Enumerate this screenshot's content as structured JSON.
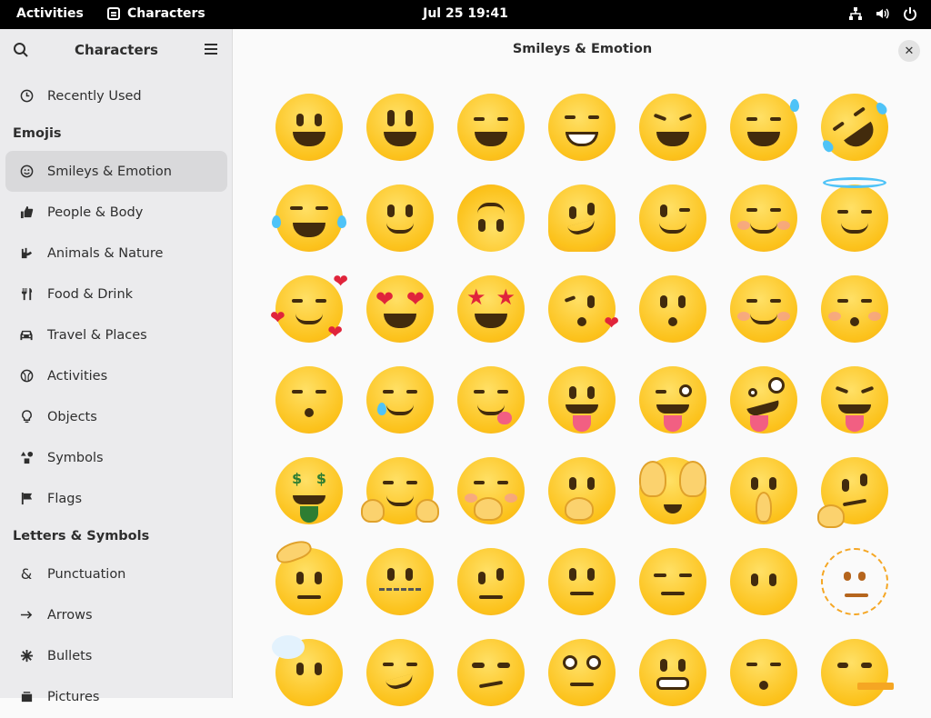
{
  "topbar": {
    "activities": "Activities",
    "app_name": "Characters",
    "clock": "Jul 25  19:41",
    "tray_icons": [
      "network-icon",
      "volume-icon",
      "power-icon"
    ]
  },
  "sidebar": {
    "title": "Characters",
    "items_top": [
      {
        "label": "Recently Used",
        "icon": "clock-icon"
      }
    ],
    "section_emojis": "Emojis",
    "emoji_items": [
      {
        "label": "Smileys & Emotion",
        "icon": "smiley-icon",
        "active": true
      },
      {
        "label": "People & Body",
        "icon": "thumbs-up-icon"
      },
      {
        "label": "Animals & Nature",
        "icon": "animal-icon"
      },
      {
        "label": "Food & Drink",
        "icon": "cutlery-icon"
      },
      {
        "label": "Travel & Places",
        "icon": "car-icon"
      },
      {
        "label": "Activities",
        "icon": "ball-icon"
      },
      {
        "label": "Objects",
        "icon": "lightbulb-icon"
      },
      {
        "label": "Symbols",
        "icon": "shapes-icon"
      },
      {
        "label": "Flags",
        "icon": "flag-icon"
      }
    ],
    "section_letters": "Letters & Symbols",
    "letter_items": [
      {
        "label": "Punctuation",
        "icon": "ampersand-icon"
      },
      {
        "label": "Arrows",
        "icon": "arrow-icon"
      },
      {
        "label": "Bullets",
        "icon": "bullet-icon"
      },
      {
        "label": "Pictures",
        "icon": "picture-icon"
      }
    ]
  },
  "main": {
    "title": "Smileys & Emotion",
    "close_label": "✕",
    "emoji_names": [
      "grinning-face",
      "grinning-face-big-eyes",
      "grinning-face-smiling-eyes",
      "beaming-face",
      "grinning-squinting-face",
      "grinning-face-sweat",
      "rolling-on-floor-laughing",
      "face-tears-of-joy",
      "slightly-smiling-face",
      "upside-down-face",
      "melting-face",
      "winking-face",
      "smiling-face-smiling-eyes",
      "smiling-face-halo",
      "smiling-face-hearts",
      "smiling-face-heart-eyes",
      "star-struck",
      "face-blowing-kiss",
      "kissing-face",
      "smiling-face",
      "kissing-face-closed-eyes",
      "kissing-face-smiling-eyes",
      "smiling-face-tear",
      "face-savoring-food",
      "face-with-tongue",
      "winking-face-tongue",
      "zany-face",
      "squinting-face-tongue",
      "money-mouth-face",
      "smiling-face-open-hands",
      "face-hand-over-mouth",
      "face-open-eyes-hand-over-mouth",
      "face-peeking-eye",
      "shushing-face",
      "thinking-face",
      "saluting-face",
      "zipper-mouth-face",
      "face-raised-eyebrow",
      "neutral-face",
      "expressionless-face",
      "face-without-mouth",
      "dotted-line-face",
      "face-in-clouds",
      "smirking-face",
      "unamused-face",
      "face-rolling-eyes",
      "grimacing-face",
      "face-exhaling",
      "lying-face"
    ]
  }
}
